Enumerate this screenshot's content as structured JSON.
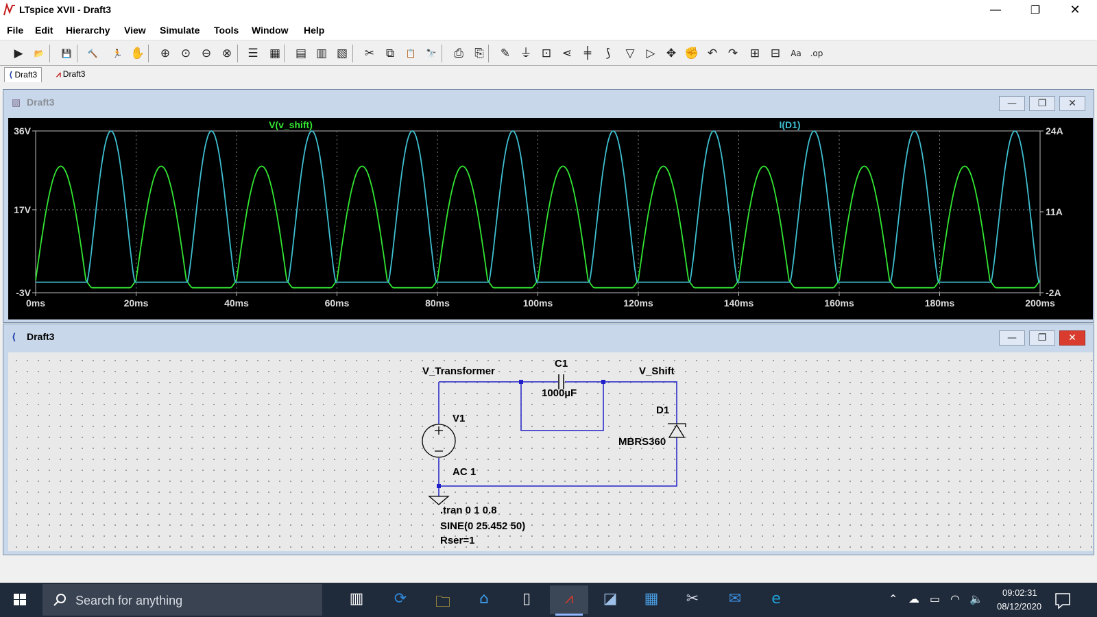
{
  "app": {
    "title": "LTspice XVII - Draft3"
  },
  "window_controls": {
    "minimize": "—",
    "restore": "❐",
    "close": "✕"
  },
  "menu": [
    "File",
    "Edit",
    "Hierarchy",
    "View",
    "Simulate",
    "Tools",
    "Window",
    "Help"
  ],
  "toolbar": {
    "icons": [
      "new-schematic-icon",
      "open-icon",
      "save-icon",
      "control-panel-icon",
      "run-icon",
      "halt-icon",
      "zoom-in-icon",
      "zoom-full-icon",
      "zoom-out-icon",
      "zoom-cancel-icon",
      "autorange-icon",
      "grid-icon",
      "tile-horizontal-icon",
      "cascade-icon",
      "tile-vertical-icon",
      "cut-icon",
      "copy-icon",
      "paste-icon",
      "find-icon",
      "print-icon",
      "print-setup-icon",
      "wire-icon",
      "ground-icon",
      "label-net-icon",
      "resistor-icon",
      "capacitor-icon",
      "inductor-icon",
      "diode-icon",
      "component-icon",
      "move-icon",
      "drag-icon",
      "undo-icon",
      "redo-icon",
      "rotate-icon",
      "mirror-icon",
      "text-icon",
      "spice-directive-icon"
    ],
    "glyphs": [
      "▶",
      "📂",
      "💾",
      "🔨",
      "🏃",
      "✋",
      "⊕",
      "⊙",
      "⊖",
      "⊗",
      "☰",
      "▦",
      "▤",
      "▥",
      "▧",
      "✂",
      "⧉",
      "📋",
      "🔭",
      "⎙",
      "⎘",
      "✎",
      "⏚",
      "⊡",
      "⋖",
      "╪",
      "⟆",
      "▽",
      "▷",
      "✥",
      "✊",
      "↶",
      "↷",
      "⊞",
      "⊟",
      "Aa",
      ".op"
    ]
  },
  "tabs": [
    {
      "label": "Draft3",
      "icon": "schematic-icon",
      "glyph": "⟨",
      "active": true
    },
    {
      "label": "Draft3",
      "icon": "waveform-icon",
      "glyph": "⩘",
      "active": false
    }
  ],
  "waveform_window": {
    "title": "Draft3",
    "icon_glyph": "▨",
    "buttons": {
      "minimize": "—",
      "restore": "❐",
      "close": "✕"
    }
  },
  "schematic_window": {
    "title": "Draft3",
    "icon_glyph": "⟨",
    "buttons": {
      "minimize": "—",
      "restore": "❐",
      "close": "✕"
    },
    "labels": {
      "net_transformer": "V_Transformer",
      "net_shift": "V_Shift",
      "cap_name": "C1",
      "cap_value": "1000µF",
      "source_name": "V1",
      "source_value": "AC 1",
      "diode_name": "D1",
      "diode_model": "MBRS360",
      "directive_tran": ".tran 0 1 0.8",
      "directive_sine": "SINE(0 25.452 50)",
      "directive_rser": "Rser=1"
    },
    "colors": {
      "wire": "#2020c8",
      "component": "#000000",
      "junction": "#2020c8"
    }
  },
  "chart_data": {
    "type": "line",
    "x_axis": {
      "range": [
        0,
        200
      ],
      "unit": "ms",
      "ticks": [
        "0ms",
        "20ms",
        "40ms",
        "60ms",
        "80ms",
        "100ms",
        "120ms",
        "140ms",
        "160ms",
        "180ms",
        "200ms"
      ]
    },
    "y_left": {
      "range": [
        -3,
        36
      ],
      "ticks": [
        "36V",
        "17V",
        "-3V"
      ]
    },
    "y_right": {
      "range": [
        -2,
        24
      ],
      "ticks": [
        "24A",
        "11A",
        "-2A"
      ]
    },
    "grid": true,
    "background": "#000000",
    "series": [
      {
        "name": "V(v_shift)",
        "color": "#33e633",
        "axis": "left",
        "description_of_shape": "half-wave sine pulses peaking near 27V, negative lobes near -2V, period 20ms",
        "peak_times_ms": [
          5,
          25,
          45,
          65,
          85,
          105,
          125,
          145,
          165,
          185
        ],
        "peak_value": 27.5,
        "trough_value": -1.8
      },
      {
        "name": "I(D1)",
        "color": "#3fbfd0",
        "axis": "right",
        "description_of_shape": "narrow current pulses reaching ~24A, baseline ~-1A",
        "peak_times_ms": [
          15,
          35,
          55,
          75,
          95,
          115,
          135,
          155,
          175,
          195
        ],
        "peak_value": 24,
        "baseline": -0.3
      }
    ]
  },
  "taskbar": {
    "search_placeholder": "Search for anything",
    "apps": [
      "task-view-icon",
      "sync-icon",
      "file-explorer-icon",
      "library-icon",
      "notepad-icon",
      "ltspice-icon",
      "sketch-icon",
      "calculator-icon",
      "snipping-icon",
      "mail-icon",
      "edge-icon"
    ],
    "tray": [
      "chevron-up-icon",
      "onedrive-icon",
      "battery-icon",
      "wifi-icon",
      "volume-icon"
    ],
    "time": "09:02:31",
    "date": "08/12/2020",
    "notification": "notification-icon"
  }
}
